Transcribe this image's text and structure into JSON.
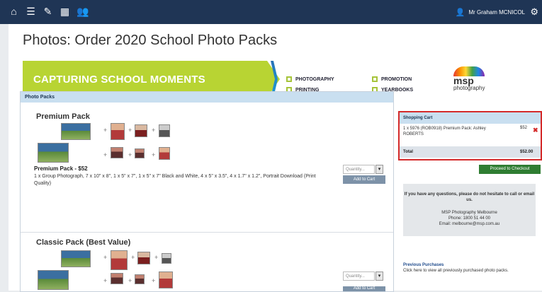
{
  "topbar": {
    "nav_icons": [
      "home-icon",
      "list-icon",
      "pencil-icon",
      "grid-icon",
      "group-icon"
    ],
    "user_name": "Mr Graham MCNICOL",
    "user_icon": "user-icon",
    "settings_icon": "gear-icon"
  },
  "page": {
    "title": "Photos: Order 2020 School Photo Packs"
  },
  "banner": {
    "headline": "CAPTURING SCHOOL MOMENTS",
    "services": [
      "PHOTOGRAPHY",
      "PRINTING",
      "PROMOTION",
      "YEARBOOKS"
    ],
    "logo_text": "msp",
    "logo_sub": "photography"
  },
  "packs": {
    "header": "Photo Packs",
    "items": [
      {
        "name": "Premium Pack",
        "title_price": "Premium Pack - $52",
        "description": "1 x Group Photograph, 7 x 10\" x 8\", 1 x 5\" x 7\", 1 x 5\" x 7\" Black and White, 4 x 5\" x 3.5\", 4 x 1.7\" x 1.2\", Portrait Download (Print Quality)",
        "quantity_placeholder": "Quantity...",
        "add_button": "Add to Cart"
      },
      {
        "name": "Classic Pack (Best Value)",
        "quantity_placeholder": "Quantity...",
        "add_button": "Add to Cart"
      }
    ]
  },
  "cart": {
    "header": "Shopping Cart",
    "item_text": "1 x 5976 (ROB0918) Premium Pack: Ashley ROBERTS",
    "item_price": "$52",
    "total_label": "Total",
    "total_value": "$52.00",
    "checkout_button": "Proceed to Checkout"
  },
  "help": {
    "question": "If you have any questions, please do not hesitate to call or email us.",
    "company": "MSP Photography Melbourne",
    "phone": "Phone: 1800 51 44 00",
    "email": "Email: melbourne@msp.com.au"
  },
  "previous": {
    "title": "Previous Purchases",
    "description": "Click here to view all previously purchased photo packs."
  },
  "colors": {
    "topbar": "#1f3555",
    "banner": "#b8d433",
    "cart_border": "#d42a2a",
    "checkout": "#2f7d32"
  }
}
